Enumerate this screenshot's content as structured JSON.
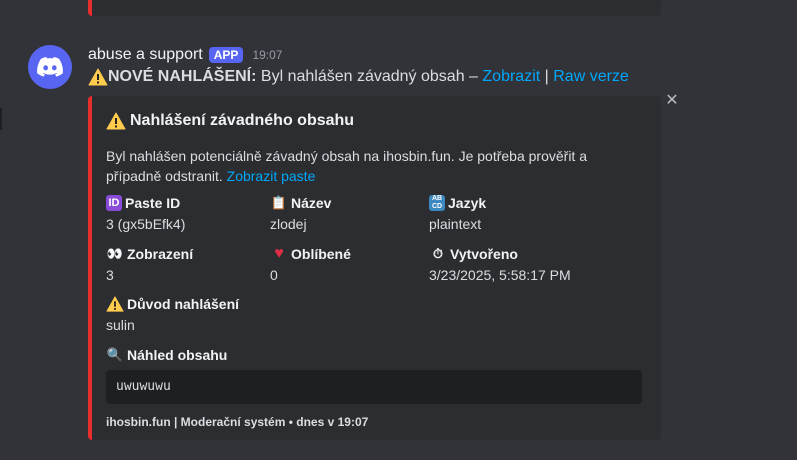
{
  "message": {
    "username": "abuse a support",
    "badge": "APP",
    "timestamp": "19:07",
    "content_bold": "NOVÉ NAHLÁŠENÍ:",
    "content_text": " Byl nahlášen závadný obsah – ",
    "link_view": "Zobrazit",
    "separator": " | ",
    "link_raw": "Raw verze"
  },
  "embed": {
    "accent_color": "#e82d2d",
    "title": "Nahlášení závadného obsahu",
    "description": "Byl nahlášen potenciálně závadný obsah na ihosbin.fun. Je potřeba prověřit a případně odstranit. ",
    "description_link": "Zobrazit paste",
    "fields": {
      "paste_id": {
        "name": "Paste ID",
        "value": "3 (gx5bEfk4)",
        "icon": "id-icon"
      },
      "nazev": {
        "name": "Název",
        "value": "zlodej",
        "icon": "clipboard-icon"
      },
      "jazyk": {
        "name": "Jazyk",
        "value": "plaintext",
        "icon": "abcd-icon"
      },
      "zobrazeni": {
        "name": "Zobrazení",
        "value": "3",
        "icon": "eyes-icon"
      },
      "oblibene": {
        "name": "Oblíbené",
        "value": "0",
        "icon": "heart-icon"
      },
      "vytvoreno": {
        "name": "Vytvořeno",
        "value": "3/23/2025, 5:58:17 PM",
        "icon": "stopwatch-icon"
      },
      "duvod": {
        "name": "Důvod nahlášení",
        "value": "sulin",
        "icon": "warning-icon"
      },
      "nahled": {
        "name": "Náhled obsahu",
        "icon": "magnifier-icon"
      }
    },
    "code_preview": "uwuwuwu",
    "footer": "ihosbin.fun | Moderační systém • dnes v 19:07"
  }
}
